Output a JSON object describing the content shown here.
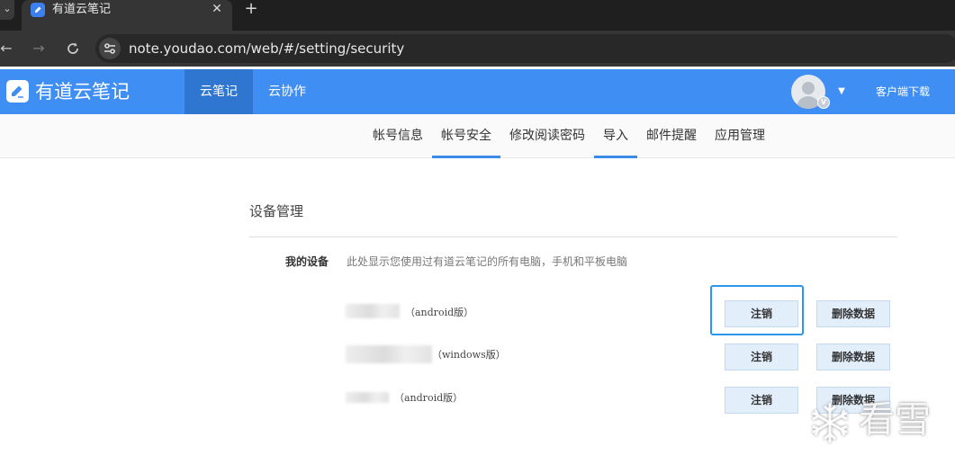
{
  "browser": {
    "tab_title": "有道云笔记",
    "tab_close": "✕",
    "new_tab": "+",
    "overflow": "⌄",
    "url": "note.youdao.com/web/#/setting/security"
  },
  "header": {
    "logo_text": "有道云笔记",
    "tabs": [
      {
        "label": "云笔记",
        "active": true
      },
      {
        "label": "云协作",
        "active": false
      }
    ],
    "vip_badge": "V",
    "download_label": "客户端下载"
  },
  "subnav": {
    "items": [
      {
        "label": "帐号信息",
        "active": false
      },
      {
        "label": "帐号安全",
        "active": true
      },
      {
        "label": "修改阅读密码",
        "active": false
      },
      {
        "label": "导入",
        "active": true
      },
      {
        "label": "邮件提醒",
        "active": false
      },
      {
        "label": "应用管理",
        "active": false
      }
    ]
  },
  "devices_section": {
    "title": "设备管理",
    "label": "我的设备",
    "description": "此处显示您使用过有道云笔记的所有电脑，手机和平板电脑",
    "devices": [
      {
        "type": "（android版）",
        "logout_label": "注销",
        "delete_label": "删除数据",
        "focused": true
      },
      {
        "type": "（windows版）",
        "logout_label": "注销",
        "delete_label": "删除数据",
        "focused": false
      },
      {
        "type": "（android版）",
        "logout_label": "注销",
        "delete_label": "删除数据",
        "focused": false
      }
    ]
  },
  "watermark": {
    "text": "看雪"
  },
  "colors": {
    "brand_blue": "#3f8ef3",
    "active_tab": "#2e76cf",
    "focus_ring": "#2a97ea",
    "button_bg": "#e3eefb"
  }
}
